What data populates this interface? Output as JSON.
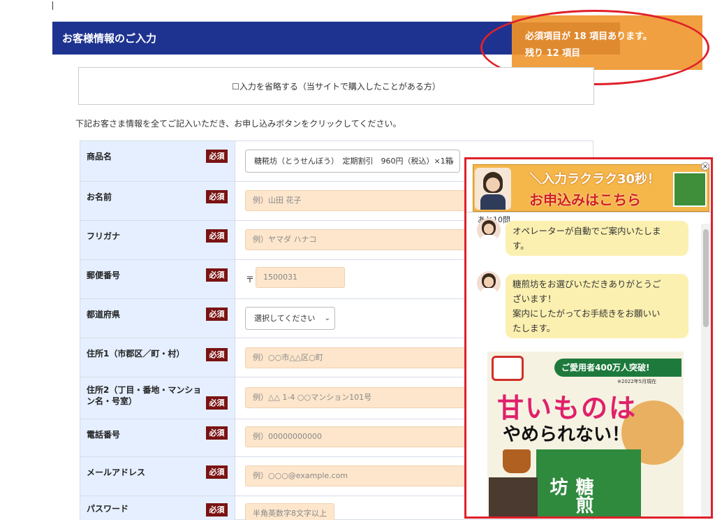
{
  "header": {
    "title": "お客様情報のご入力"
  },
  "required_notice": {
    "line1": "必須項目が 18 項目あります。",
    "line2": "残り 12 項目"
  },
  "skip": {
    "label": "☐入力を省略する（当サイトで購入したことがある方）"
  },
  "intro_text": "下記お客さま情報を全てご記入いただき、お申し込みボタンをクリックしてください。",
  "required_badge": "必須",
  "form": {
    "rows": [
      {
        "label": "商品名",
        "select": "糖糀坊（とうせんぼう）　定期割引　960円（税込）×1箱"
      },
      {
        "label": "お名前",
        "placeholder": "例）山田 花子"
      },
      {
        "label": "フリガナ",
        "placeholder": "例）ヤマダ ハナコ"
      },
      {
        "label": "郵便番号",
        "postal_mark": "〒",
        "placeholder": "1500031"
      },
      {
        "label": "都道府県",
        "select": "選択してください"
      },
      {
        "label": "住所1（市郡区／町・村）",
        "placeholder": "例）○○市△△区○町"
      },
      {
        "label": "住所2（丁目・番地・マンション名・号室）",
        "placeholder": "例）△△ 1-4 ○○マンション101号"
      },
      {
        "label": "電話番号",
        "placeholder": "例）00000000000"
      },
      {
        "label": "メールアドレス",
        "placeholder": "例）○○○@example.com"
      },
      {
        "label": "パスワード",
        "placeholder": "半角英数字8文字以上"
      }
    ]
  },
  "chat": {
    "banner_line1": "＼入力ラクラク30秒！",
    "banner_line2": "お申込みはこちら",
    "close_icon": "close-icon",
    "remaining": "あと10問",
    "messages": [
      "オペレーターが自動でご案内いたしま\nす。",
      "糖煎坊をお選びいただきありがとうご\nざいます！\n案内にしたがってお手続きをお願いい\nたします。"
    ],
    "promo": {
      "ribbon": "ご愛用者400万人突破!",
      "sub": "※2022年5月現在",
      "headline1": "甘いものは",
      "headline2": "やめられない！",
      "box_title": "糖煎坊"
    }
  },
  "colors": {
    "header_bg": "#1e3390",
    "notice_bg": "#f0a040",
    "badge_bg": "#7a1313",
    "input_bg": "#fde6cc",
    "label_bg": "#e5efff",
    "highlight_red": "#e0202a"
  }
}
